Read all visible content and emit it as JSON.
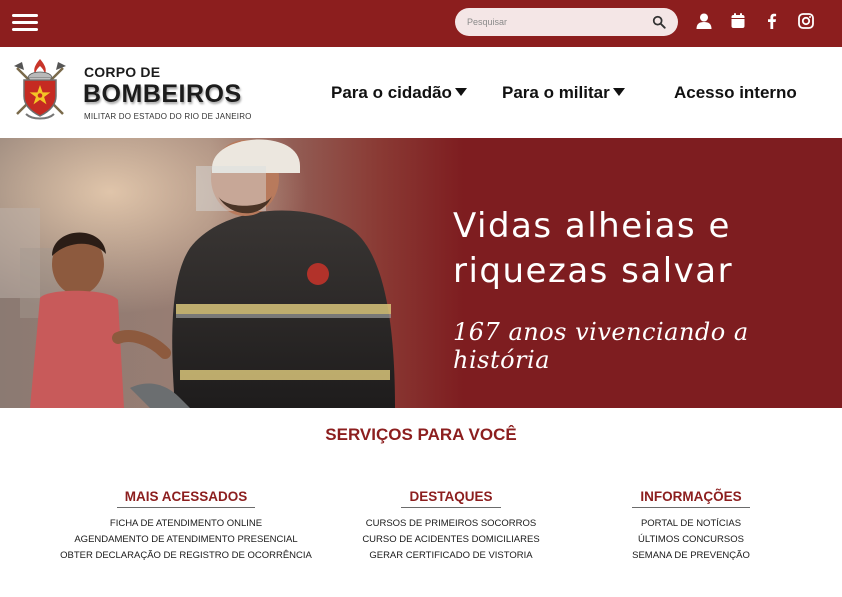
{
  "topbar": {
    "search_placeholder": "Pesquisar",
    "icons": [
      "menu-icon",
      "search-icon",
      "user-icon",
      "calendar-icon",
      "facebook-icon",
      "instagram-icon"
    ],
    "bg_color": "#8c1e1e"
  },
  "header": {
    "brand_top": "CORPO DE",
    "brand_main": "BOMBEIROS",
    "brand_sub": "MILITAR DO ESTADO DO RIO DE JANEIRO",
    "nav": [
      {
        "label": "Para o cidadão",
        "has_dropdown": true
      },
      {
        "label": "Para o militar",
        "has_dropdown": true
      },
      {
        "label": "Acesso interno",
        "has_dropdown": false
      }
    ]
  },
  "hero": {
    "title": "Vidas alheias e riquezas salvar",
    "subtitle": "167 anos vivenciando a história",
    "bg_color": "#7e1d20"
  },
  "services": {
    "title": "SERVIÇOS PARA VOCÊ",
    "columns": [
      {
        "heading": "MAIS ACESSADOS",
        "items": [
          "FICHA DE ATENDIMENTO ONLINE",
          "AGENDAMENTO DE ATENDIMENTO PRESENCIAL",
          "OBTER DECLARAÇÃO DE REGISTRO DE OCORRÊNCIA"
        ]
      },
      {
        "heading": "DESTAQUES",
        "items": [
          "CURSOS DE PRIMEIROS SOCORROS",
          "CURSO DE ACIDENTES DOMICILIARES",
          "GERAR CERTIFICADO DE VISTORIA"
        ]
      },
      {
        "heading": "INFORMAÇÕES",
        "items": [
          "PORTAL DE NOTÍCIAS",
          "ÚLTIMOS CONCURSOS",
          "SEMANA DE PREVENÇÃO"
        ]
      }
    ],
    "accent_color": "#8c1e1e"
  }
}
